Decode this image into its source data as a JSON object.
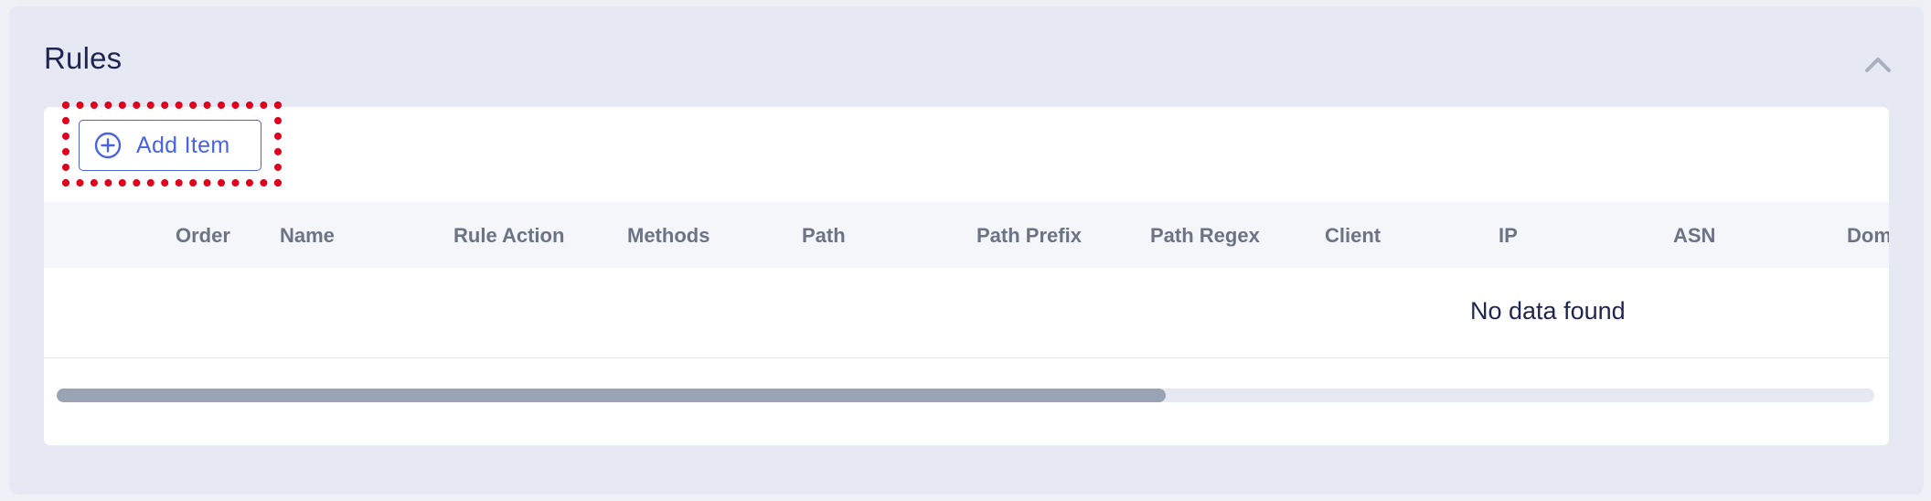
{
  "panel": {
    "title": "Rules",
    "collapse_icon": "chevron-up-icon"
  },
  "toolbar": {
    "add_label": "Add Item",
    "add_icon": "plus-circle-icon"
  },
  "table": {
    "columns": [
      "Order",
      "Name",
      "Rule Action",
      "Methods",
      "Path",
      "Path Prefix",
      "Path Regex",
      "Client",
      "IP",
      "ASN",
      "Doma"
    ],
    "rows": [],
    "empty_message": "No data found"
  },
  "scrollbar": {
    "thumb_fraction": 0.61
  },
  "colors": {
    "accent": "#4a63e0",
    "highlight": "#e0001b",
    "panel_bg": "#e6e9f4",
    "header_text": "#6b7385",
    "title_text": "#1d2550"
  }
}
